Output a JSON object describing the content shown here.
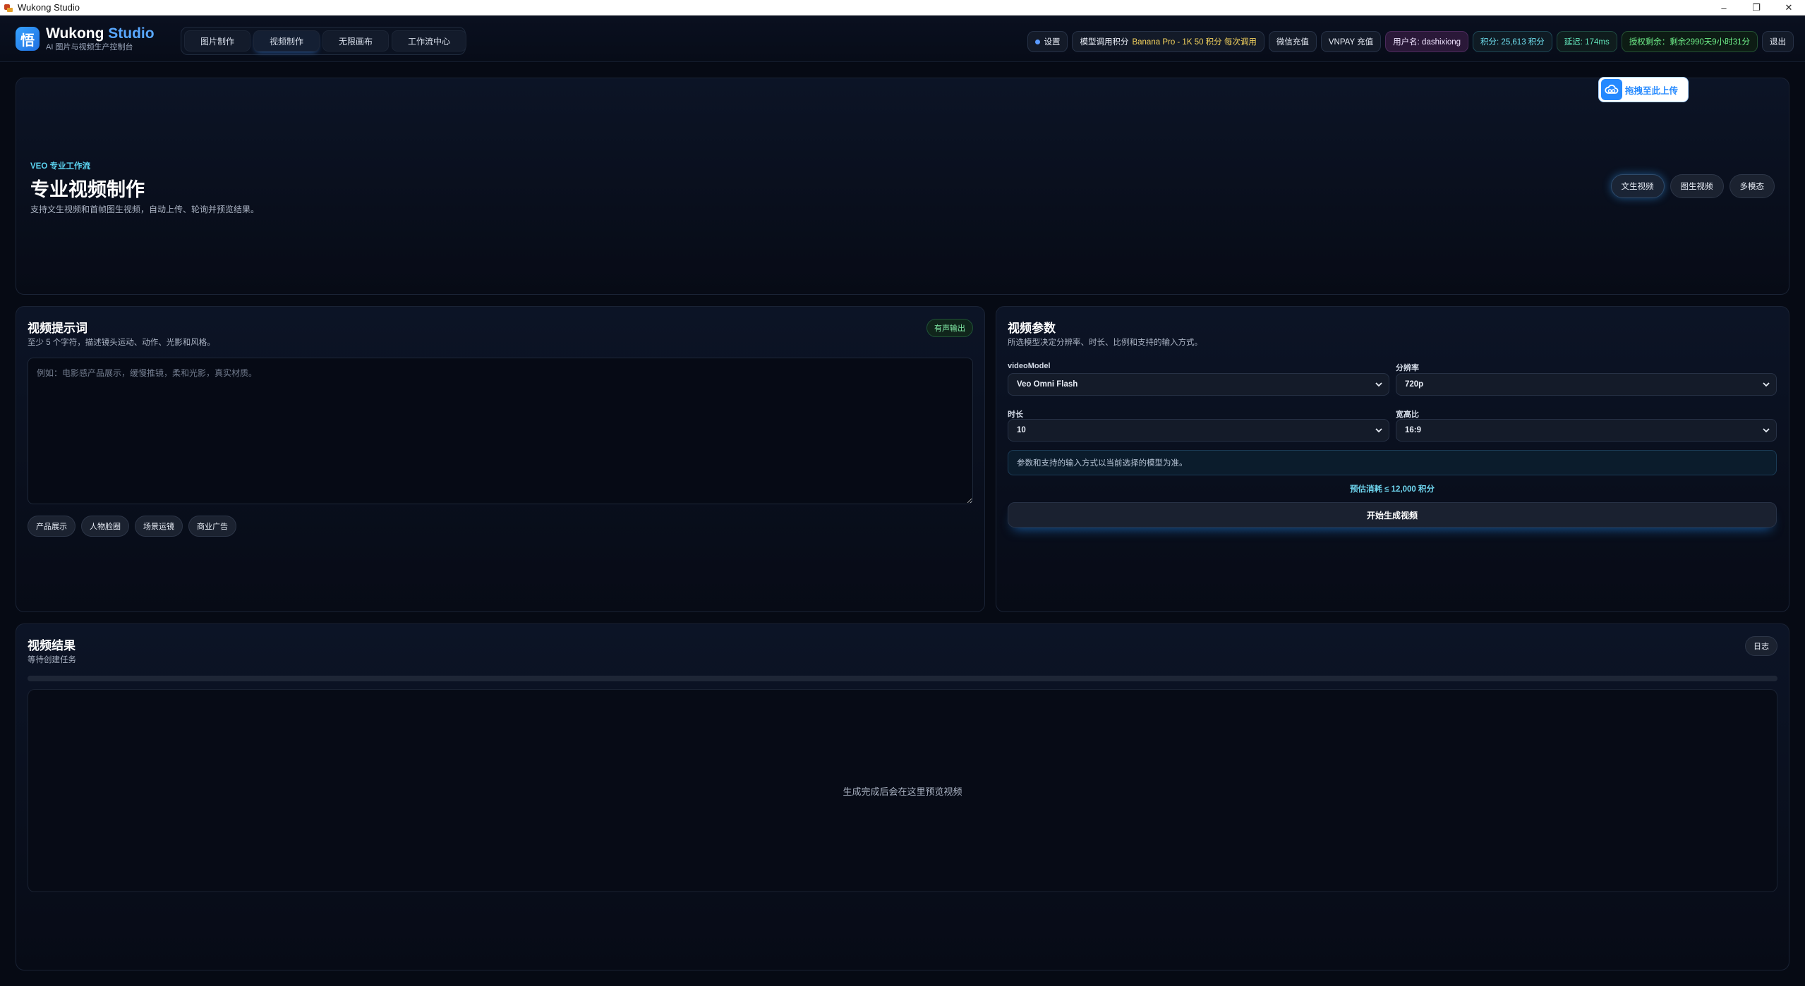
{
  "window": {
    "title": "Wukong Studio",
    "controls": {
      "minimize": "–",
      "restore": "❐",
      "close": "✕"
    }
  },
  "brand": {
    "logo_glyph": "悟",
    "title_main": "Wukong",
    "title_accent": "Studio",
    "subtitle": "AI 图片与视频生产控制台"
  },
  "nav": {
    "tabs": [
      {
        "label": "图片制作",
        "active": false
      },
      {
        "label": "视频制作",
        "active": true
      },
      {
        "label": "无限画布",
        "active": false
      },
      {
        "label": "工作流中心",
        "active": false
      }
    ]
  },
  "status": {
    "settings_label": "设置",
    "model_label": "模型调用积分",
    "model_value": "Banana Pro - 1K 50 积分 每次调用",
    "wechat_recharge": "微信充值",
    "vnpay_recharge": "VNPAY 充值",
    "user": "用户名: dashixiong",
    "points": "积分: 25,613 积分",
    "latency": "延迟: 174ms",
    "license": "授权剩余：剩余2990天9小时31分",
    "logout": "退出"
  },
  "hero": {
    "eyebrow": "VEO 专业工作流",
    "title": "专业视频制作",
    "description": "支持文生视频和首帧图生视频，自动上传、轮询并预览结果。",
    "upload_label": "拖拽至此上传",
    "modes": [
      {
        "label": "文生视频",
        "active": true
      },
      {
        "label": "图生视频",
        "active": false
      },
      {
        "label": "多模态",
        "active": false
      }
    ]
  },
  "prompt": {
    "title": "视频提示词",
    "subtitle": "至少 5 个字符，描述镜头运动、动作、光影和风格。",
    "audio_badge": "有声输出",
    "placeholder": "例如：电影感产品展示，缓慢推镜，柔和光影，真实材质。",
    "value": "",
    "chips": [
      "产品展示",
      "人物脸圈",
      "场景运镜",
      "商业广告"
    ]
  },
  "params": {
    "title": "视频参数",
    "subtitle": "所选模型决定分辨率、时长、比例和支持的输入方式。",
    "model_label": "videoModel",
    "model_value": "Veo Omni Flash",
    "resolution_label": "分辨率",
    "resolution_value": "720p",
    "duration_label": "时长",
    "duration_value": "10",
    "aspect_label": "宽高比",
    "aspect_value": "16:9",
    "note": "参数和支持的输入方式以当前选择的模型为准。",
    "estimate": "预估消耗 ≤ 12,000 积分",
    "generate_label": "开始生成视频"
  },
  "result": {
    "title": "视频结果",
    "subtitle": "等待创建任务",
    "log_label": "日志",
    "progress": 0,
    "empty_text": "生成完成后会在这里预览视频"
  },
  "colors": {
    "background": "#060a14",
    "accent_blue": "#59a8ff",
    "eyebrow_cyan": "#5bd3f0",
    "audio_green": "#7fe6a3",
    "license_green": "#6ff08a",
    "points_cyan": "#6fe0ef"
  },
  "icons": {
    "settings": "dot-icon",
    "upload": "cloud-upload-icon",
    "select": "chevron-down-icon"
  }
}
